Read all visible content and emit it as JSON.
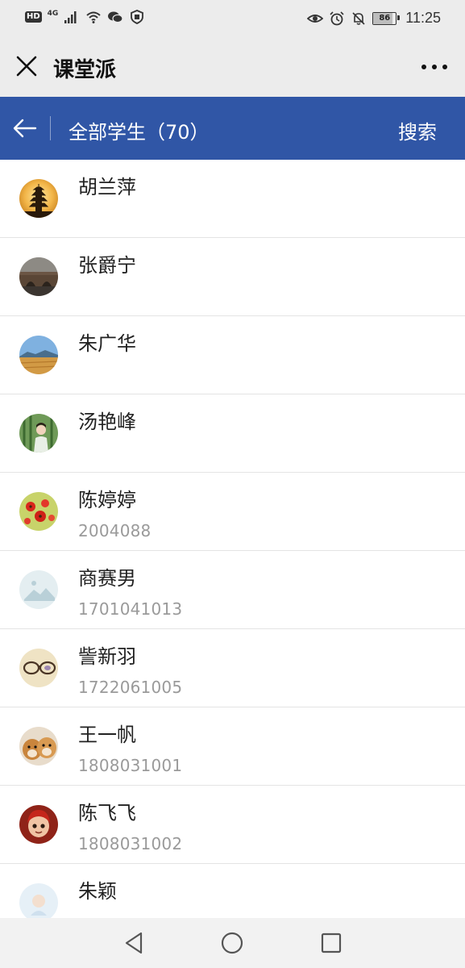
{
  "status_bar": {
    "hd": "HD",
    "network": "4G",
    "battery": "86",
    "battery_level": 0.86,
    "time": "11:25"
  },
  "app_bar": {
    "title": "课堂派",
    "close_icon": "close-icon",
    "more_icon": "more-icon"
  },
  "header": {
    "title": "全部学生（70）",
    "search_label": "搜索",
    "back_icon": "arrow-left-icon",
    "background": "#3056a6"
  },
  "students": [
    {
      "name": "胡兰萍",
      "id": "",
      "avatar": "pagoda-sunset"
    },
    {
      "name": "张爵宁",
      "id": "",
      "avatar": "stone-bridge"
    },
    {
      "name": "朱广华",
      "id": "",
      "avatar": "wheat-field-sky"
    },
    {
      "name": "汤艳峰",
      "id": "",
      "avatar": "bamboo-girl"
    },
    {
      "name": "陈婷婷",
      "id": "2004088",
      "avatar": "red-flowers"
    },
    {
      "name": "商赛男",
      "id": "1701041013",
      "avatar": "placeholder-landscape"
    },
    {
      "name": "訾新羽",
      "id": "1722061005",
      "avatar": "glasses"
    },
    {
      "name": "王一帆",
      "id": "1808031001",
      "avatar": "shiba-dogs"
    },
    {
      "name": "陈飞飞",
      "id": "1808031002",
      "avatar": "cartoon-girl"
    },
    {
      "name": "朱颖",
      "id": "",
      "avatar": "light-cartoon"
    }
  ],
  "nav_bar": {
    "back_icon": "triangle-back-icon",
    "home_icon": "circle-home-icon",
    "recents_icon": "square-recents-icon"
  }
}
